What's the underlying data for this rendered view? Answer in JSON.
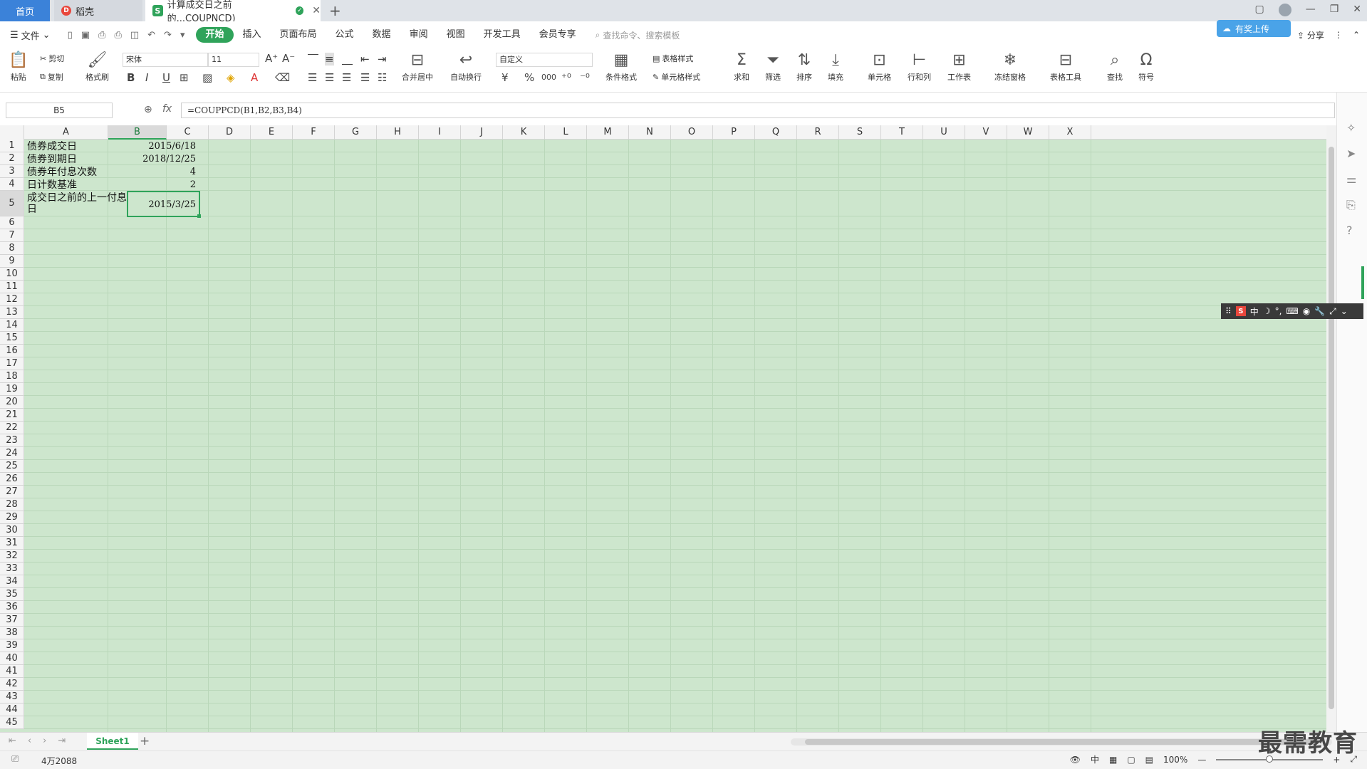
{
  "tabs": {
    "home": "首页",
    "doke": "稻壳",
    "doc": "计算成交日之前的...COUPNCD)"
  },
  "menu": {
    "file": "文件",
    "items": [
      "开始",
      "插入",
      "页面布局",
      "公式",
      "数据",
      "审阅",
      "视图",
      "开发工具",
      "会员专享"
    ],
    "search_placeholder": "查找命令、搜索模板",
    "share": "分享",
    "cloud_badge": "有奖上传"
  },
  "ribbon": {
    "paste": "粘贴",
    "cut": "剪切",
    "copy": "复制",
    "format_painter": "格式刷",
    "font_name": "宋体",
    "font_size": "11",
    "merge_center": "合并居中",
    "wrap": "自动换行",
    "number_format": "自定义",
    "table_style": "表格样式",
    "cond_format": "条件格式",
    "cell_style": "单元格样式",
    "sum": "求和",
    "filter": "筛选",
    "sort": "排序",
    "fill": "填充",
    "cell": "单元格",
    "row_col": "行和列",
    "worksheet": "工作表",
    "freeze": "冻结窗格",
    "table_tools": "表格工具",
    "find": "查找",
    "symbol": "符号",
    "currency": "¥",
    "percent": "%",
    "thousands": "000"
  },
  "formula_bar": {
    "name_box": "B5",
    "fx": "fx",
    "formula": "=COUPPCD(B1,B2,B3,B4)"
  },
  "columns": [
    "A",
    "B",
    "C",
    "D",
    "E",
    "F",
    "G",
    "H",
    "I",
    "J",
    "K",
    "L",
    "M",
    "N",
    "O",
    "P",
    "Q",
    "R",
    "S",
    "T",
    "U",
    "V",
    "W",
    "X"
  ],
  "rows": [
    "1",
    "2",
    "3",
    "4",
    "5",
    "6",
    "7",
    "8",
    "9",
    "10",
    "11",
    "12",
    "13",
    "14",
    "15",
    "16",
    "17",
    "18",
    "19",
    "20",
    "21",
    "22",
    "23",
    "24",
    "25",
    "26",
    "27",
    "28",
    "29",
    "30",
    "31",
    "32",
    "33",
    "34",
    "35",
    "36",
    "37",
    "38",
    "39",
    "40",
    "41",
    "42",
    "43",
    "44",
    "45"
  ],
  "cells": {
    "A1": "债券成交日",
    "B1": "2015/6/18",
    "A2": "债券到期日",
    "B2": "2018/12/25",
    "A3": "债券年付息次数",
    "B3": "4",
    "A4": "日计数基准",
    "B4": "2",
    "A5": "成交日之前的上一付息日",
    "B5": "2015/3/25"
  },
  "ime": {
    "mode": "中"
  },
  "sheets": [
    "Sheet1"
  ],
  "status": {
    "count": "4万2088",
    "input_mode": "中",
    "zoom": "100%"
  },
  "watermark": "最需教育"
}
